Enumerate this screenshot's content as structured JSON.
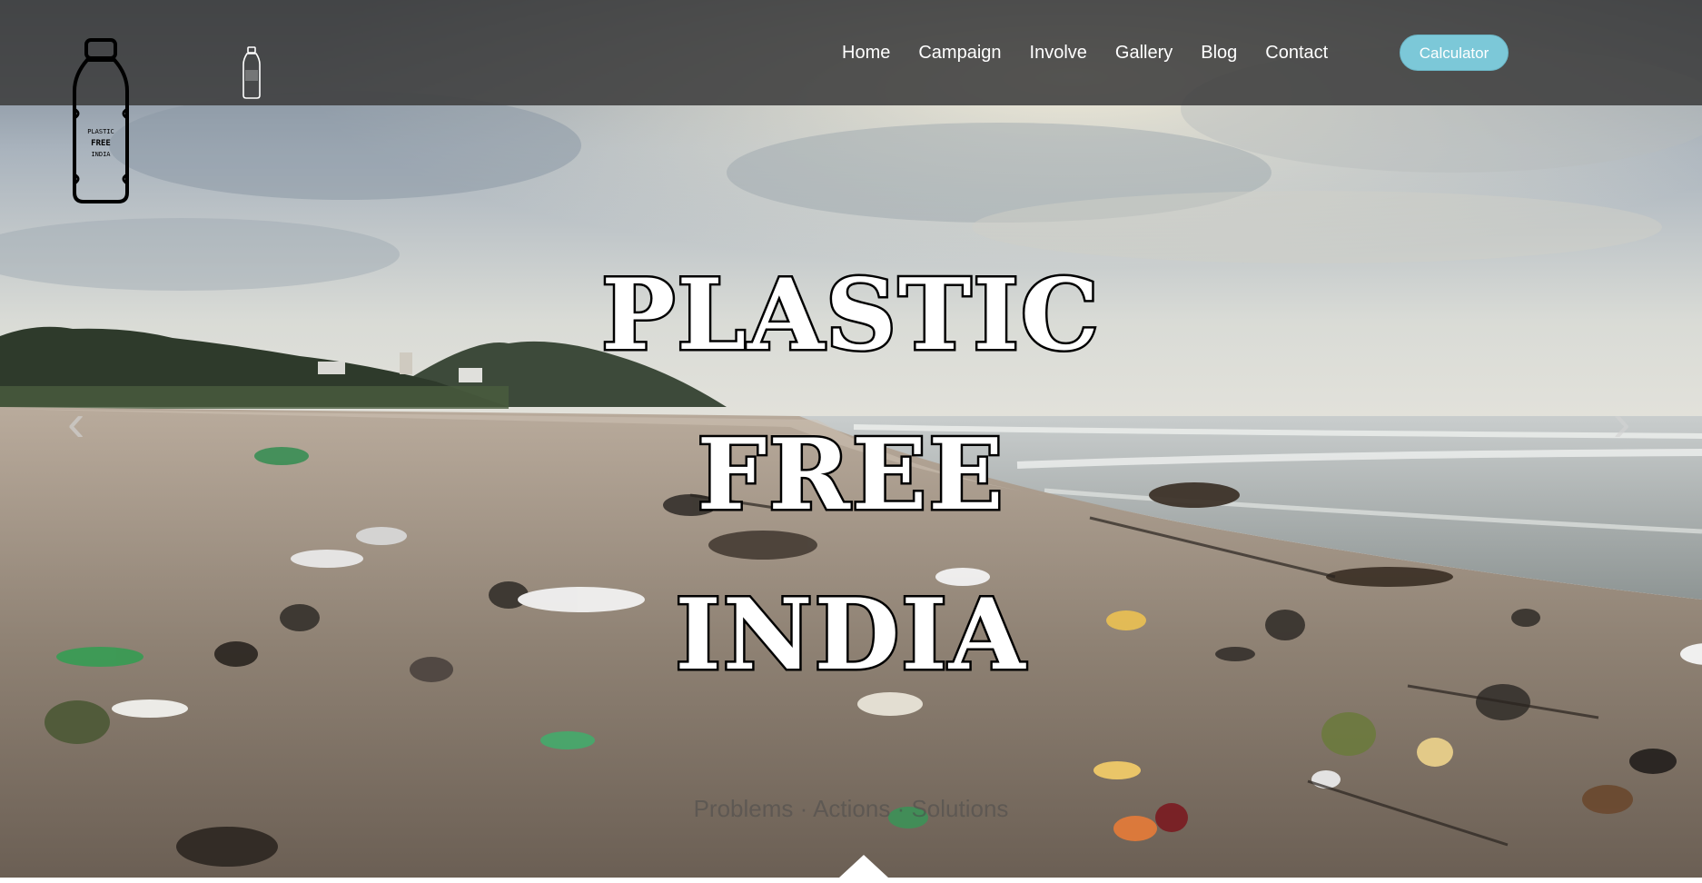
{
  "hero": {
    "title_lines": [
      "PLASTIC",
      "FREE",
      "INDIA"
    ],
    "prev_icon": "chevron-left-icon",
    "next_icon": "chevron-right-icon",
    "prev_glyph": "‹",
    "next_glyph": "›",
    "faded_caption": "Problems · Actions · Solutions"
  },
  "navbar": {
    "logo_text": [
      "PLASTIC",
      "FREE",
      "INDIA"
    ],
    "logo_icon": "bottle-logo-icon",
    "small_icon": "bottle-icon",
    "links": [
      "Home",
      "Campaign",
      "Involve",
      "Gallery",
      "Blog",
      "Contact"
    ],
    "calculator_label": "Calculator"
  },
  "colors": {
    "navbar_bg": "#3e3e3e",
    "accent": "#7cc8d8",
    "text_light": "#ffffff"
  }
}
